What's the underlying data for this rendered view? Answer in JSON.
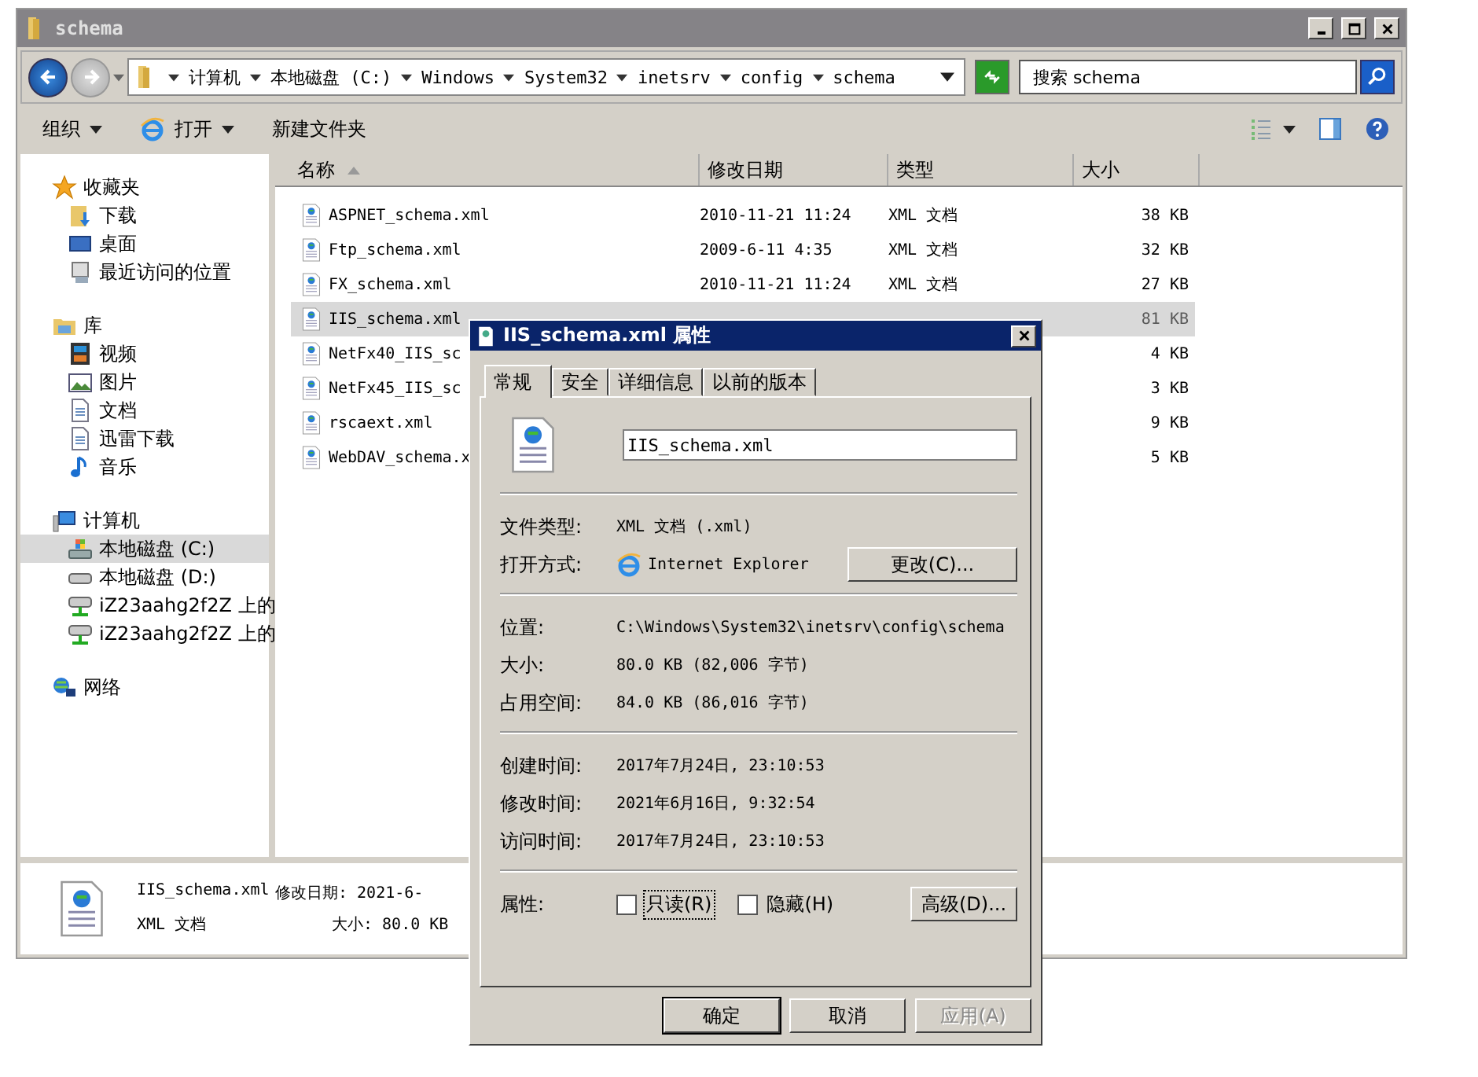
{
  "window": {
    "title": "schema"
  },
  "address": {
    "crumbs": [
      "计算机",
      "本地磁盘 (C:)",
      "Windows",
      "System32",
      "inetsrv",
      "config",
      "schema"
    ]
  },
  "search": {
    "placeholder": "搜索 schema"
  },
  "toolbar": [
    {
      "label": "组织",
      "kind": "menu"
    },
    {
      "label": "打开",
      "kind": "app-menu"
    },
    {
      "label": "新建文件夹",
      "kind": "plain"
    }
  ],
  "sidebar": [
    {
      "label": "收藏夹",
      "kind": "star",
      "selected": false,
      "children": [
        {
          "label": "下载",
          "kind": "download",
          "selected": false
        },
        {
          "label": "桌面",
          "kind": "desktop",
          "selected": false
        },
        {
          "label": "最近访问的位置",
          "kind": "recent",
          "selected": false
        }
      ]
    },
    {
      "label": "库",
      "kind": "library",
      "selected": false,
      "children": [
        {
          "label": "视频",
          "kind": "video",
          "selected": false
        },
        {
          "label": "图片",
          "kind": "picture",
          "selected": false
        },
        {
          "label": "文档",
          "kind": "document",
          "selected": false
        },
        {
          "label": "迅雷下载",
          "kind": "document",
          "selected": false
        },
        {
          "label": "音乐",
          "kind": "music",
          "selected": false
        }
      ]
    },
    {
      "label": "计算机",
      "kind": "computer",
      "selected": false,
      "children": [
        {
          "label": "本地磁盘 (C:)",
          "kind": "system-drive",
          "selected": true
        },
        {
          "label": "本地磁盘 (D:)",
          "kind": "drive",
          "selected": false
        },
        {
          "label": "iZ23aahg2f2Z 上的",
          "kind": "network-drive",
          "selected": false
        },
        {
          "label": "iZ23aahg2f2Z 上的",
          "kind": "network-drive",
          "selected": false
        }
      ]
    },
    {
      "label": "网络",
      "kind": "network",
      "selected": false
    }
  ],
  "columns": [
    {
      "label": "名称",
      "sorted": true
    },
    {
      "label": "修改日期",
      "sorted": false
    },
    {
      "label": "类型",
      "sorted": false
    },
    {
      "label": "大小",
      "sorted": false
    }
  ],
  "files": [
    {
      "name": "ASPNET_schema.xml",
      "date": "2010-11-21 11:24",
      "type": "XML 文档",
      "size": "38 KB",
      "selected": false
    },
    {
      "name": "Ftp_schema.xml",
      "date": "2009-6-11 4:35",
      "type": "XML 文档",
      "size": "32 KB",
      "selected": false
    },
    {
      "name": "FX_schema.xml",
      "date": "2010-11-21 11:24",
      "type": "XML 文档",
      "size": "27 KB",
      "selected": false
    },
    {
      "name": "IIS_schema.xml",
      "size": "81 KB",
      "selected": true
    },
    {
      "name": "NetFx40_IIS_sc",
      "size": "4 KB",
      "selected": false
    },
    {
      "name": "NetFx45_IIS_sc",
      "size": "3 KB",
      "selected": false
    },
    {
      "name": "rscaext.xml",
      "size": "9 KB",
      "selected": false
    },
    {
      "name": "WebDAV_schema.x",
      "size": "5 KB",
      "selected": false
    }
  ],
  "details": {
    "name": "IIS_schema.xml",
    "modified": "修改日期: 2021-6-",
    "type": "XML 文档",
    "size": "大小: 80.0 KB"
  },
  "dialog": {
    "title": "IIS_schema.xml 属性",
    "tabs": [
      {
        "label": "常规",
        "selected": true
      },
      {
        "label": "安全",
        "selected": false
      },
      {
        "label": "详细信息",
        "selected": false
      },
      {
        "label": "以前的版本",
        "selected": false
      }
    ],
    "filename": "IIS_schema.xml",
    "sections": [
      [
        {
          "label": "文件类型:",
          "value": "XML 文档 (.xml)",
          "kind": "text"
        },
        {
          "label": "打开方式:",
          "value": "Internet Explorer",
          "kind": "app",
          "button": "更改(C)..."
        }
      ],
      [
        {
          "label": "位置:",
          "value": "C:\\Windows\\System32\\inetsrv\\config\\schema",
          "kind": "text"
        },
        {
          "label": "大小:",
          "value": "80.0 KB (82,006 字节)",
          "kind": "text"
        },
        {
          "label": "占用空间:",
          "value": "84.0 KB (86,016 字节)",
          "kind": "text"
        }
      ],
      [
        {
          "label": "创建时间:",
          "value": "2017年7月24日, 23:10:53",
          "kind": "text"
        },
        {
          "label": "修改时间:",
          "value": "2021年6月16日, 9:32:54",
          "kind": "text"
        },
        {
          "label": "访问时间:",
          "value": "2017年7月24日, 23:10:53",
          "kind": "text"
        }
      ]
    ],
    "attributes": {
      "label": "属性:",
      "checkboxes": [
        {
          "label": "只读(R)",
          "checked": false,
          "focused": true
        },
        {
          "label": "隐藏(H)",
          "checked": false,
          "focused": false
        }
      ],
      "button": "高级(D)..."
    },
    "buttons": [
      {
        "label": "确定",
        "disabled": false,
        "default": true
      },
      {
        "label": "取消",
        "disabled": false,
        "default": false
      },
      {
        "label": "应用(A)",
        "disabled": true,
        "default": false
      }
    ]
  }
}
